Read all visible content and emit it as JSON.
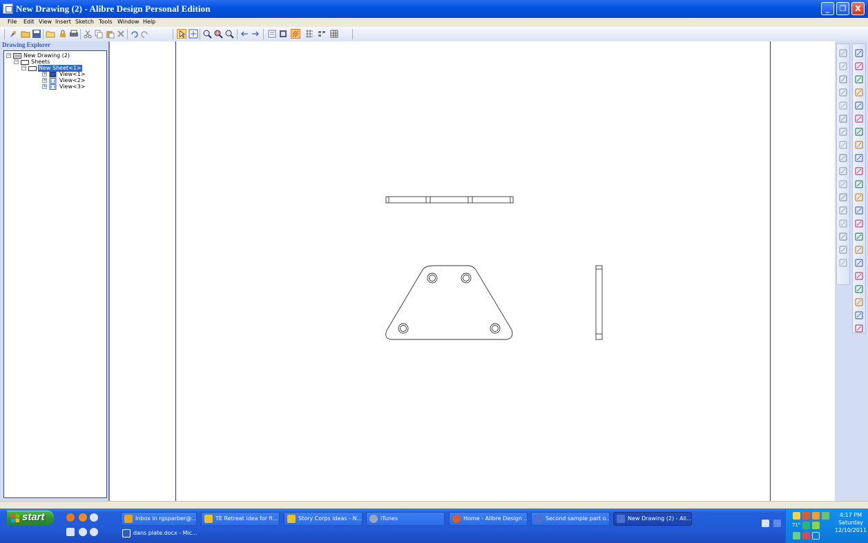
{
  "window": {
    "title": "New Drawing (2) - Alibre Design Personal Edition",
    "minimize_glyph": "_",
    "maximize_glyph": "❐",
    "close_glyph": "X"
  },
  "menu": [
    "File",
    "Edit",
    "View",
    "Insert",
    "Sketch",
    "Tools",
    "Window",
    "Help"
  ],
  "toolbar": {
    "icons": [
      "new-icon",
      "open-icon",
      "save-icon",
      "open-folder-icon",
      "lock-icon",
      "print-icon",
      "cut-icon",
      "copy-icon",
      "paste-icon",
      "delete-icon",
      "undo-icon",
      "redo-icon",
      "select-icon",
      "zoom-fit-icon",
      "zoom-in-icon",
      "zoom-window-icon",
      "zoom-out-icon",
      "previous-view-icon",
      "next-view-icon",
      "sheet-icon",
      "book-icon",
      "hatch-icon",
      "pattern-icon",
      "dimension-icon",
      "table-icon"
    ]
  },
  "explorer": {
    "title": "Drawing Explorer",
    "tree": [
      {
        "label": "New Drawing (2)",
        "level": 0,
        "toggle": "−",
        "icon": "drawing-icon"
      },
      {
        "label": "Sheets",
        "level": 1,
        "toggle": "−",
        "icon": "sheets-icon"
      },
      {
        "label": "New Sheet<1>",
        "level": 2,
        "toggle": "−",
        "icon": "sheet-icon",
        "selected": true
      },
      {
        "label": "View<1>",
        "level": 3,
        "toggle": "+",
        "icon": "view-icon"
      },
      {
        "label": "View<2>",
        "level": 3,
        "toggle": "+",
        "icon": "view-icon"
      },
      {
        "label": "View<3>",
        "level": 3,
        "toggle": "+",
        "icon": "view-icon"
      }
    ]
  },
  "right_panel": {
    "sketch_tools": [
      "smart-dimension-icon",
      "point-icon",
      "line-icon",
      "arc-icon",
      "slash-icon",
      "circle-icon",
      "arc-3pt-icon",
      "rectangle-icon",
      "ellipse-icon",
      "dot-icon",
      "centerline-icon",
      "trim-icon",
      "extend-icon",
      "fillet-icon",
      "chamfer-icon",
      "offset-icon",
      "mirror-icon"
    ],
    "drawing_tools": [
      "new-sheet-icon",
      "standard-view-icon",
      "detail-icon",
      "section-view-icon",
      "broken-view-icon",
      "break-icon",
      "auxiliary-view-icon",
      "crop-icon",
      "table-view-icon",
      "note-icon",
      "datum-icon",
      "hole-callout-icon",
      "feature-control-icon",
      "surface-finish-icon",
      "weld-icon",
      "balloon-icon",
      "center-mark-icon",
      "table-icon",
      "bom-icon",
      "text-icon",
      "revision-table-icon",
      "layers-icon"
    ]
  },
  "taskbar": {
    "start_label": "start",
    "tasks_row1": [
      {
        "label": "Inbox in rgsparber@...",
        "icon": "email-icon",
        "color": "#f0a020"
      },
      {
        "label": "TE Retreat idea for fi...",
        "icon": "document-icon",
        "color": "#f0c020"
      },
      {
        "label": "Story Corps ideas - N...",
        "icon": "document-icon",
        "color": "#f0c020"
      },
      {
        "label": "iTunes",
        "icon": "itunes-icon",
        "color": "#9aa7c0"
      },
      {
        "label": "Home - Alibre Design ...",
        "icon": "browser-icon",
        "color": "#e05a20"
      },
      {
        "label": "Second sample part o...",
        "icon": "alibre-icon",
        "color": "#4d6fd0"
      },
      {
        "label": "New Drawing (2) - Ali...",
        "icon": "alibre-drawing-icon",
        "color": "#4d6fd0",
        "active": true
      }
    ],
    "tasks_row2": [
      {
        "label": "dans plate.docx - Mic...",
        "icon": "word-icon",
        "color": "#2e5cc0"
      }
    ],
    "tray": {
      "time": "4:17 PM",
      "day": "Saturday",
      "date": "12/10/2011",
      "temperature": "71°"
    }
  },
  "colors": {
    "titlebar": "#0052df",
    "menubar": "#ece9d8",
    "panel": "#d2dcf3",
    "sheet_border": "#2d2da8",
    "selection": "#316ac5",
    "taskbar": "#245edb",
    "start_button": "#2f8f2f"
  }
}
